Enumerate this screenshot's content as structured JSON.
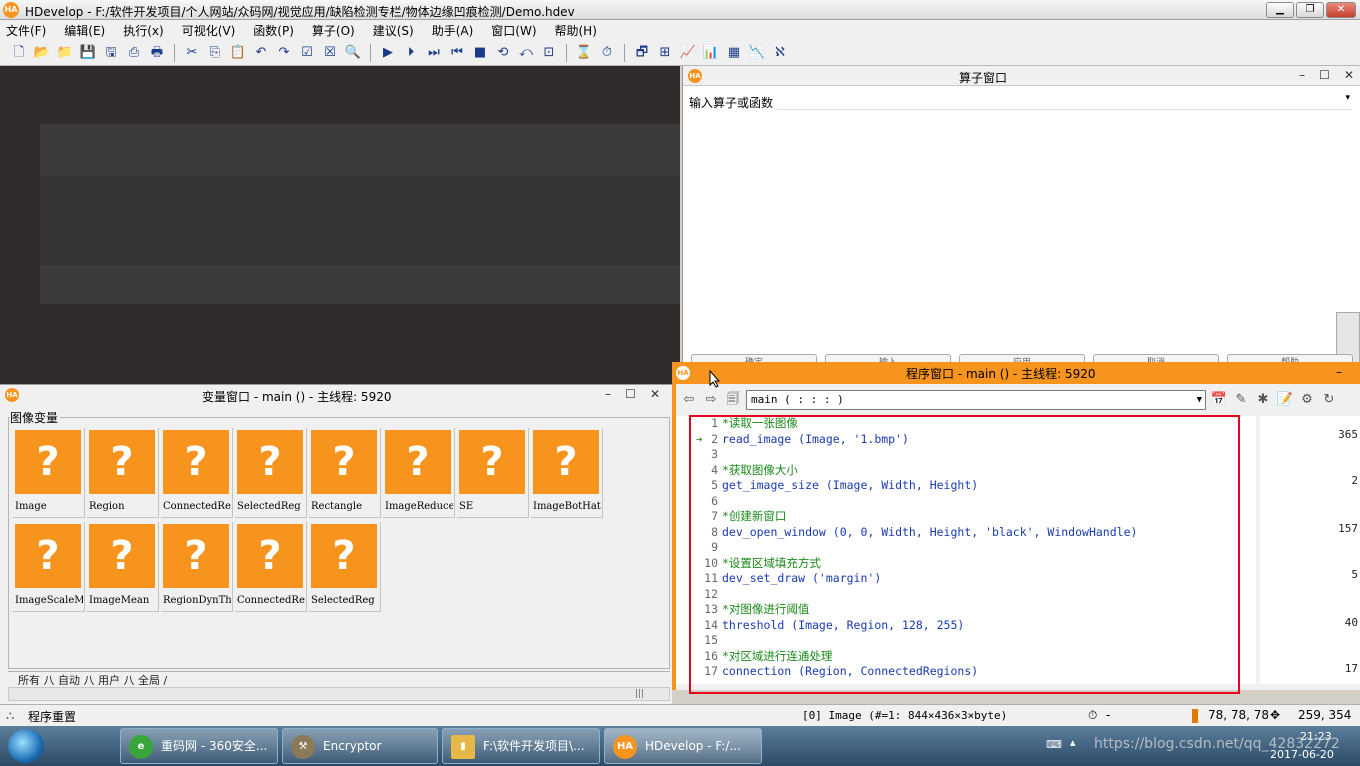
{
  "app": {
    "title": "HDevelop - F:/软件开发项目/个人网站/众码网/视觉应用/缺陷检测专栏/物体边缘凹痕检测/Demo.hdev",
    "logo": "HA"
  },
  "menu": [
    "文件(F)",
    "编辑(E)",
    "执行(x)",
    "可视化(V)",
    "函数(P)",
    "算子(O)",
    "建议(S)",
    "助手(A)",
    "窗口(W)",
    "帮助(H)"
  ],
  "operator_window": {
    "title": "算子窗口",
    "input_label": "输入算子或函数",
    "buttons": [
      "确定",
      "输入",
      "应用",
      "取消",
      "帮助"
    ]
  },
  "variable_window": {
    "title": "变量窗口 - main () - 主线程: 5920",
    "group_label": "图像变量",
    "variables": [
      "Image",
      "Region",
      "ConnectedRe",
      "SelectedReg",
      "Rectangle",
      "ImageReduce",
      "SE",
      "ImageBotHat",
      "ImageScaleM",
      "ImageMean",
      "RegionDynTh",
      "ConnectedRe",
      "SelectedReg"
    ],
    "tabs": "所有 八 自动 八 用户 八 全局 /"
  },
  "program_window": {
    "title": "程序窗口 - main () - 主线程: 5920",
    "procedure": "main ( : : : )",
    "current_line": 2,
    "lines": [
      {
        "n": "1",
        "text": "*读取一张图像",
        "kind": "comment"
      },
      {
        "n": "2",
        "text": "read_image (Image, '1.bmp')",
        "kind": "stmt"
      },
      {
        "n": "3",
        "text": "",
        "kind": "stmt"
      },
      {
        "n": "4",
        "text": "*获取图像大小",
        "kind": "comment"
      },
      {
        "n": "5",
        "text": "get_image_size (Image, Width, Height)",
        "kind": "stmt"
      },
      {
        "n": "6",
        "text": "",
        "kind": "stmt"
      },
      {
        "n": "7",
        "text": "*创建新窗口",
        "kind": "comment"
      },
      {
        "n": "8",
        "text": "dev_open_window (0, 0, Width, Height, 'black', WindowHandle)",
        "kind": "stmt"
      },
      {
        "n": "9",
        "text": "",
        "kind": "stmt"
      },
      {
        "n": "10",
        "text": "*设置区域填充方式",
        "kind": "comment"
      },
      {
        "n": "11",
        "text": "dev_set_draw ('margin')",
        "kind": "stmt"
      },
      {
        "n": "12",
        "text": "",
        "kind": "stmt"
      },
      {
        "n": "13",
        "text": "*对图像进行阈值",
        "kind": "comment"
      },
      {
        "n": "14",
        "text": "threshold (Image, Region, 128, 255)",
        "kind": "stmt"
      },
      {
        "n": "15",
        "text": "",
        "kind": "stmt"
      },
      {
        "n": "16",
        "text": "*对区域进行连通处理",
        "kind": "comment"
      },
      {
        "n": "17",
        "text": "connection (Region, ConnectedRegions)",
        "kind": "stmt"
      }
    ],
    "right_values": [
      "365",
      "2",
      "157",
      "5",
      "40",
      "17"
    ]
  },
  "status": {
    "message": "程序重置",
    "image_info": "[0] Image (#=1: 844×436×3×byte)",
    "timer": "-",
    "pixel_value": "78, 78, 78",
    "coords": "259,  354"
  },
  "taskbar": {
    "tasks": [
      "重码网 - 360安全...",
      "Encryptor",
      "F:\\软件开发项目\\...",
      "HDevelop - F:/..."
    ],
    "clock_time": "21:23",
    "clock_date": "2017-06-20",
    "watermark": "https://blog.csdn.net/qq_42832272"
  },
  "colors": {
    "halcon_orange": "#f7941d",
    "highlight_red": "#e8001c",
    "comment_green": "#1a8a1a",
    "code_blue": "#1a3bb0"
  }
}
